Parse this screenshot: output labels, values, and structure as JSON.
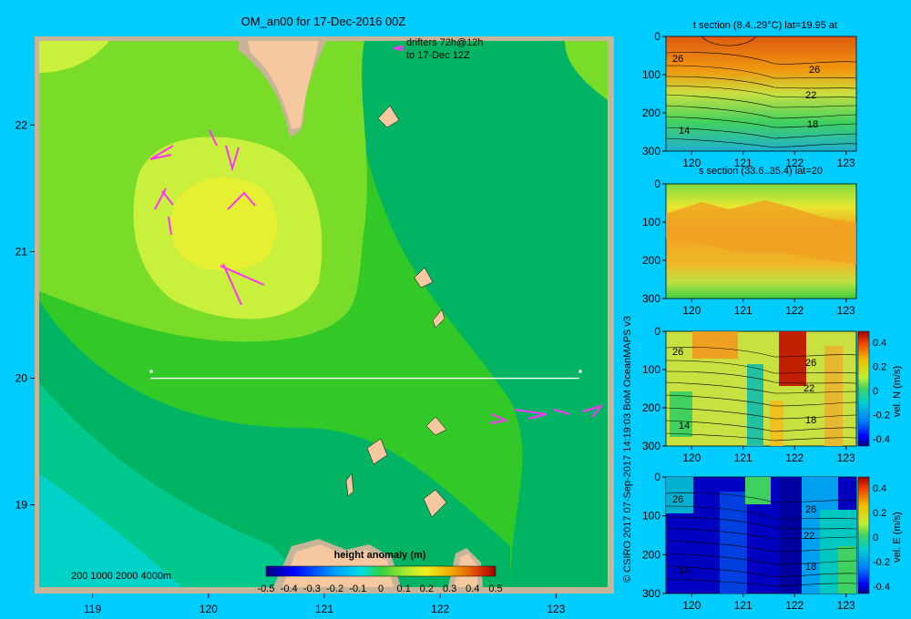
{
  "main_map": {
    "title": "OM_an00 for 17-Dec-2016 00Z",
    "drifter_note_line1": "drifters 72h@12h",
    "drifter_note_line2": "to 17-Dec 12Z",
    "depth_legend": "200  1000  2000  4000m",
    "section_line": {
      "lon_start": 119.5,
      "lon_end": 123.2,
      "lat": 20.0
    },
    "colors": {
      "border": "#c8b498",
      "land": "#f5c8a0",
      "band_dark": "#00b464",
      "band_mid": "#32c828",
      "band_light": "#78dc28",
      "band_yellow": "#c8f03c",
      "band_core": "#e6f032",
      "band_cyan": "#00d2c8",
      "drifter": "#ff32ff",
      "background": "#00ccff"
    }
  },
  "chart_data": [
    {
      "type": "heatmap",
      "title": "height anomaly (m)",
      "xlim": [
        118.5,
        123.5
      ],
      "ylim": [
        18.3,
        22.7
      ],
      "x_ticks": [
        "119",
        "120",
        "121",
        "122",
        "123"
      ],
      "y_ticks": [
        "19",
        "20",
        "21",
        "22"
      ],
      "colorbar": {
        "label": "height anomaly (m)",
        "range": [
          -0.5,
          0.5
        ],
        "tick_labels": [
          "-0.5",
          "-0.4",
          "-0.3",
          "-0.2",
          "-0.1",
          "0",
          "0.1",
          "0.2",
          "0.3",
          "0.4",
          "0.5"
        ]
      }
    },
    {
      "type": "heatmap",
      "title": "t section (8.4..29°C) lat=19.95 at",
      "xlim": [
        119.5,
        123.2
      ],
      "ylim": [
        0,
        300
      ],
      "x_ticks": [
        "120",
        "121",
        "122",
        "123"
      ],
      "y_ticks": [
        "0",
        "100",
        "200",
        "300"
      ],
      "contour_labels": [
        "26",
        "26",
        "22",
        "18",
        "14"
      ]
    },
    {
      "type": "heatmap",
      "title": "s section (33.6..35.4) lat=20",
      "xlim": [
        119.5,
        123.2
      ],
      "ylim": [
        0,
        300
      ],
      "x_ticks": [
        "120",
        "121",
        "122",
        "123"
      ],
      "y_ticks": [
        "0",
        "100",
        "200",
        "300"
      ]
    },
    {
      "type": "heatmap",
      "title": "",
      "xlim": [
        119.5,
        123.2
      ],
      "ylim": [
        0,
        300
      ],
      "x_ticks": [
        "120",
        "121",
        "122",
        "123"
      ],
      "y_ticks": [
        "0",
        "100",
        "200",
        "300"
      ],
      "contour_labels": [
        "26",
        "26",
        "22",
        "18",
        "14"
      ],
      "colorbar": {
        "label": "vel. N (m/s)",
        "range": [
          -0.4,
          0.4
        ],
        "tick_labels": [
          "0.4",
          "0.2",
          "0",
          "-0.2",
          "-0.4"
        ]
      }
    },
    {
      "type": "heatmap",
      "title": "",
      "xlim": [
        119.5,
        123.2
      ],
      "ylim": [
        0,
        300
      ],
      "x_ticks": [
        "120",
        "121",
        "122",
        "123"
      ],
      "y_ticks": [
        "0",
        "100",
        "200",
        "300"
      ],
      "contour_labels": [
        "26",
        "26",
        "22",
        "18",
        "14"
      ],
      "colorbar": {
        "label": "vel. E (m/s)",
        "range": [
          -0.4,
          0.4
        ],
        "tick_labels": [
          "0.4",
          "0.2",
          "0",
          "-0.2",
          "-0.4"
        ]
      }
    }
  ],
  "credit": "© CSIRO 2017  07-Sep-2017 14:19:03 BoM OceanMAPS v3"
}
